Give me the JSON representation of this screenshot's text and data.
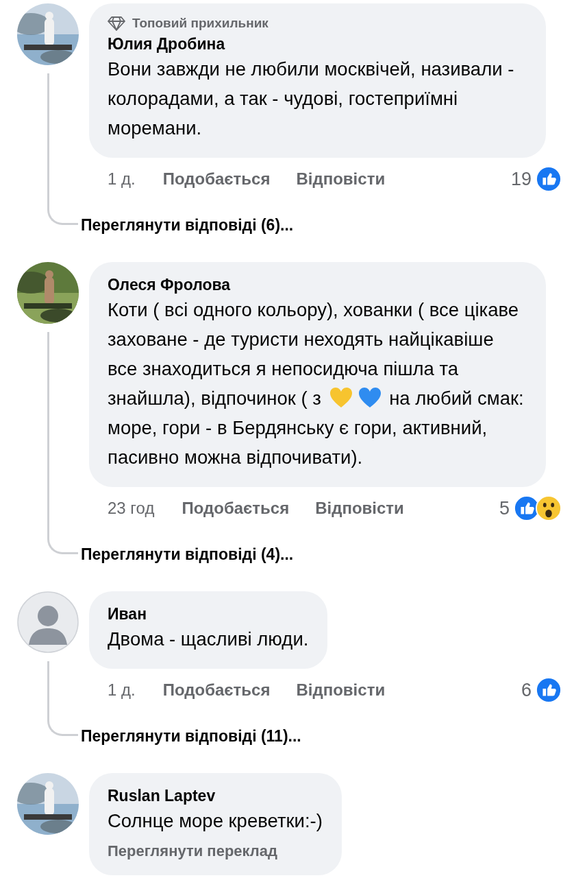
{
  "comments": [
    {
      "avatar": {
        "kind": "picture"
      },
      "badge": "Топовий прихильник",
      "author": "Юлия Дробина",
      "body": [
        {
          "kind": "text",
          "text": "Вони завжди не любили москвічей, називали - колорадами, а так - чудові, гостеприїмні моремани."
        }
      ],
      "time": "1 д.",
      "like": "Подобається",
      "reply": "Відповісти",
      "reaction_count": "19",
      "reactions": [
        {
          "kind": "like"
        }
      ],
      "replies": "Переглянути відповіді (6)..."
    },
    {
      "avatar": {
        "kind": "picture"
      },
      "author": "Олеся Фролова",
      "body": [
        {
          "kind": "text",
          "text": "Коти ( всі одного кольору), хованки ( все цікаве заховане - де туристи неходять найцікавіше все знаходиться я непосидюча пішла та знайшла), відпочинок ( з"
        },
        {
          "kind": "heart",
          "color": "#f7c42f"
        },
        {
          "kind": "heart",
          "color": "#2f8cf0"
        },
        {
          "kind": "text",
          "text": "на любий смак: море, гори - в Бердянську є гори, активний, пасивно можна відпочивати)."
        }
      ],
      "time": "23 год",
      "like": "Подобається",
      "reply": "Відповісти",
      "reaction_count": "5",
      "reactions": [
        {
          "kind": "like"
        },
        {
          "kind": "wow"
        }
      ],
      "replies": "Переглянути відповіді (4)..."
    },
    {
      "avatar": {
        "kind": "default"
      },
      "author": "Иван",
      "body": [
        {
          "kind": "text",
          "text": "Двома - щасливі люди."
        }
      ],
      "time": "1 д.",
      "like": "Подобається",
      "reply": "Відповісти",
      "reaction_count": "6",
      "reactions": [
        {
          "kind": "like"
        }
      ],
      "replies": "Переглянути відповіді (11)..."
    },
    {
      "avatar": {
        "kind": "picture"
      },
      "author": "Ruslan Laptev",
      "body": [
        {
          "kind": "text",
          "text": "Солнце море креветки:-)"
        }
      ],
      "translate": "Переглянути переклад"
    }
  ]
}
